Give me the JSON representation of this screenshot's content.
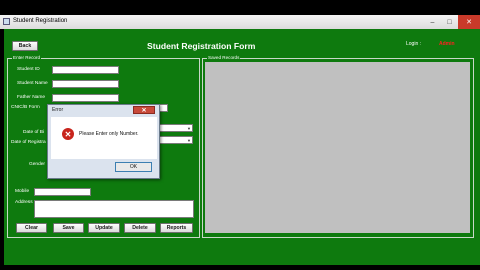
{
  "window": {
    "title": "Student Registration",
    "minimize": "–",
    "maximize": "□",
    "close": "✕"
  },
  "header": {
    "back_label": "Back",
    "form_title": "Student Registration Form",
    "login_label": "Login :",
    "login_user": "Admin"
  },
  "enter_record": {
    "legend": "Enter Record",
    "labels": {
      "student_id": "Student ID",
      "student_name": "Student Name",
      "father_name": "Father Name",
      "cnic": "CNIC/B Form",
      "dob": "Date of Bi",
      "date_reg": "Date of Registra",
      "gender": "Gender",
      "mobile": "Mobile",
      "address": "Address"
    }
  },
  "saved_records": {
    "legend": "Saved Records"
  },
  "actions": {
    "clear": "Clear",
    "save": "Save",
    "update": "Update",
    "delete": "Delete",
    "reports": "Reports"
  },
  "dialog": {
    "title": "Error",
    "close": "✕",
    "message": "Please Enter only Number.",
    "ok": "OK"
  },
  "colors": {
    "form_bg": "#0e7a0e",
    "error_red": "#c8241c"
  }
}
